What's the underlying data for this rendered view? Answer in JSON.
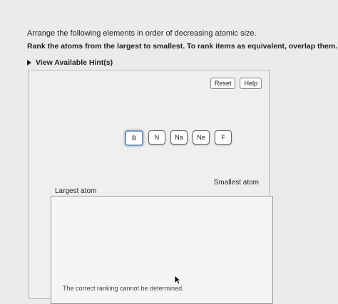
{
  "instructions": {
    "line1": "Arrange the following elements in order of decreasing atomic size.",
    "line2": "Rank the atoms from the largest to smallest. To rank items as equivalent, overlap them."
  },
  "hint": {
    "label": "View Available Hint(s)"
  },
  "toolbar": {
    "reset": "Reset",
    "help": "Help"
  },
  "atoms": [
    "B",
    "N",
    "Na",
    "Ne",
    "F"
  ],
  "ranking": {
    "smallest_label": "Smallest atom",
    "largest_label": "Largest atom"
  },
  "footer": {
    "message": "The correct ranking cannot be determined."
  }
}
